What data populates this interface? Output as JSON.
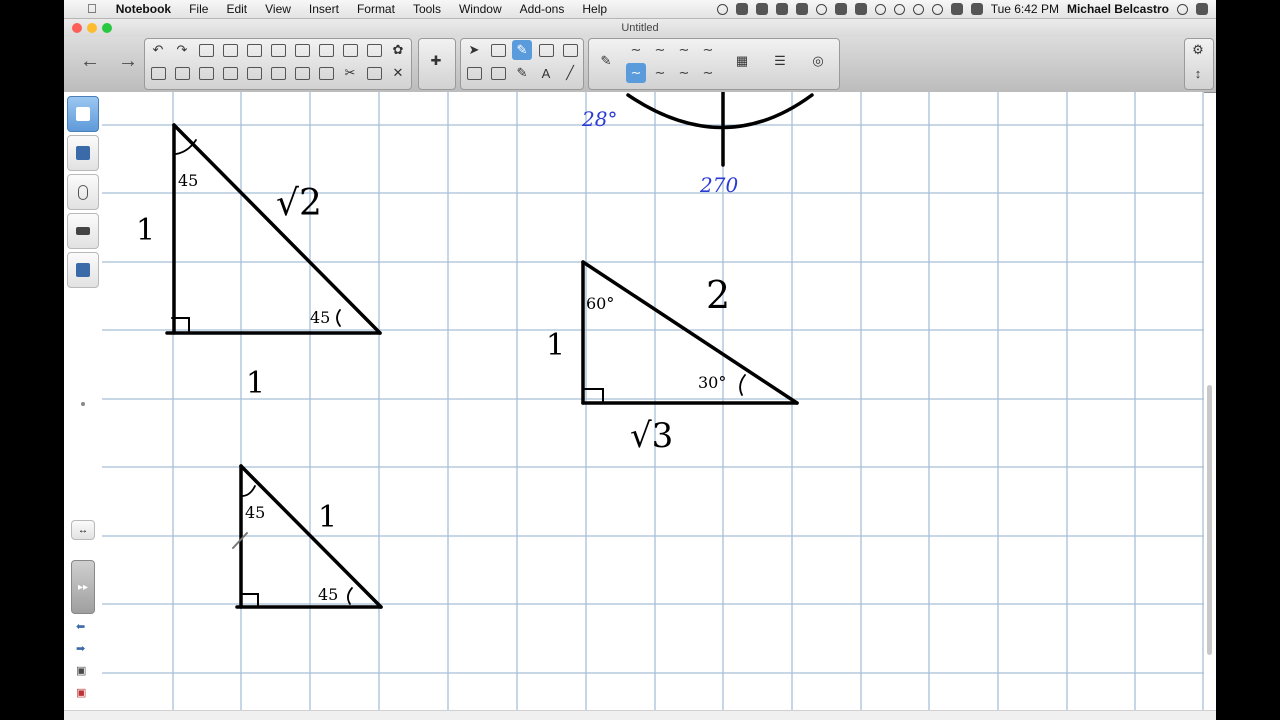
{
  "menubar": {
    "app_name": "Notebook",
    "items": [
      "File",
      "Edit",
      "View",
      "Insert",
      "Format",
      "Tools",
      "Window",
      "Add-ons",
      "Help"
    ],
    "clock": "Tue 6:42 PM",
    "user": "Michael Belcastro",
    "apple_glyph": ""
  },
  "window": {
    "title": "Untitled",
    "close_color": "#fc5f57",
    "min_color": "#fdbc2e",
    "max_color": "#28c840"
  },
  "toolbar": {
    "back_glyph": "←",
    "forward_glyph": "→",
    "selected_tool": "pen",
    "accent": "#5a9bdc"
  },
  "sidebar": {
    "tabs": [
      "page-sorter",
      "gallery",
      "attachments",
      "properties",
      "add-ons"
    ],
    "selected": "page-sorter"
  },
  "canvas": {
    "grid_color": "#a7bfd8",
    "ink_color": "#000000",
    "blue_ink_color": "#2a3ad6",
    "labels": {
      "t1_left": "1",
      "t1_bottom": "1",
      "t1_hyp": "√2",
      "t1_top_angle": "45",
      "t1_right_angle": "45",
      "t2_left": "1",
      "t2_hyp": "2",
      "t2_bottom": "√3",
      "t2_top_angle": "60°",
      "t2_right_angle": "30°",
      "t3_hyp": "1",
      "t3_top_angle": "45",
      "t3_right_angle": "45",
      "blue_a": "28°",
      "blue_b": "270"
    }
  }
}
